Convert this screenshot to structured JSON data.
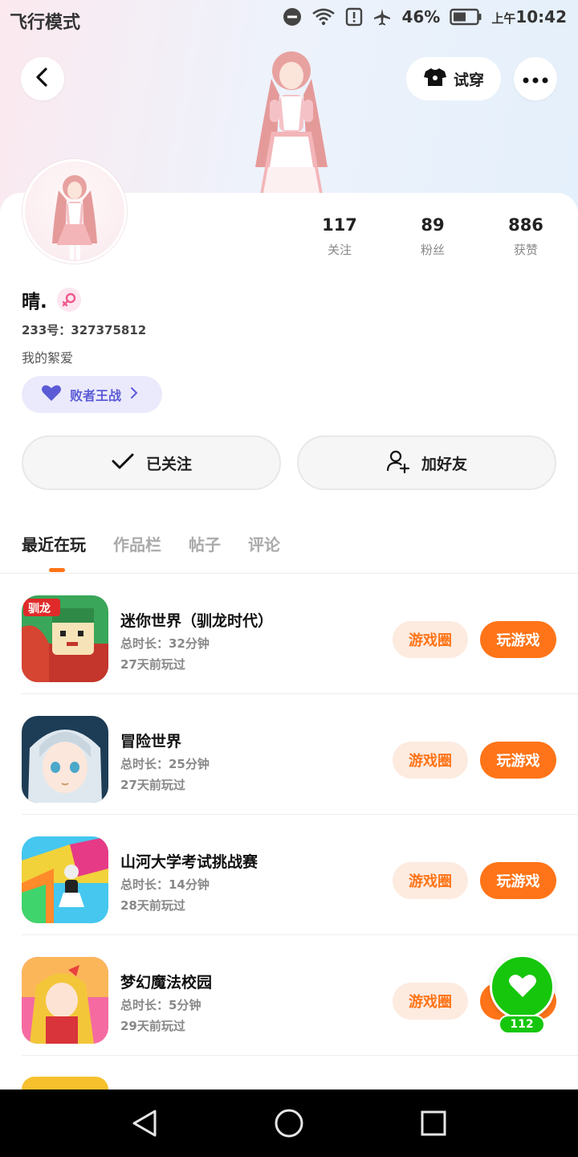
{
  "status_bar": {
    "left_text": "飞行模式",
    "battery_pct": "46%",
    "time_prefix": "上午",
    "time": "10:42",
    "icons": [
      "do-not-disturb-icon",
      "wifi-icon",
      "alert-icon",
      "airplane-icon",
      "battery-icon"
    ]
  },
  "header": {
    "tryon_label": "试穿"
  },
  "profile": {
    "name": "晴.",
    "uid": "233号：327375812",
    "bio": "我的絮爱",
    "badge_label": "败者王战",
    "stats": [
      {
        "value": "117",
        "label": "关注"
      },
      {
        "value": "89",
        "label": "粉丝"
      },
      {
        "value": "886",
        "label": "获赞"
      }
    ]
  },
  "actions": {
    "follow_label": "已关注",
    "add_friend_label": "加好友"
  },
  "tabs": [
    {
      "label": "最近在玩",
      "active": true
    },
    {
      "label": "作品栏",
      "active": false
    },
    {
      "label": "帖子",
      "active": false
    },
    {
      "label": "评论",
      "active": false
    }
  ],
  "games": [
    {
      "title": "迷你世界（驯龙时代）",
      "duration": "总时长：32分钟",
      "last_played": "27天前玩过",
      "circle_label": "游戏圈",
      "play_label": "玩游戏",
      "icon_text": "驯龙"
    },
    {
      "title": "冒险世界",
      "duration": "总时长：25分钟",
      "last_played": "27天前玩过",
      "circle_label": "游戏圈",
      "play_label": "玩游戏"
    },
    {
      "title": "山河大学考试挑战赛",
      "duration": "总时长：14分钟",
      "last_played": "28天前玩过",
      "circle_label": "游戏圈",
      "play_label": "玩游戏"
    },
    {
      "title": "梦幻魔法校园",
      "duration": "总时长：5分钟",
      "last_played": "29天前玩过",
      "circle_label": "游戏圈",
      "play_label": "玩游戏"
    }
  ],
  "fab": {
    "count": "112"
  },
  "colors": {
    "accent": "#ff7418",
    "accent_light": "#fdebe0",
    "badge_bg": "#ebeafc",
    "badge_text": "#5b5bd6",
    "fab_green": "#16c60c"
  }
}
